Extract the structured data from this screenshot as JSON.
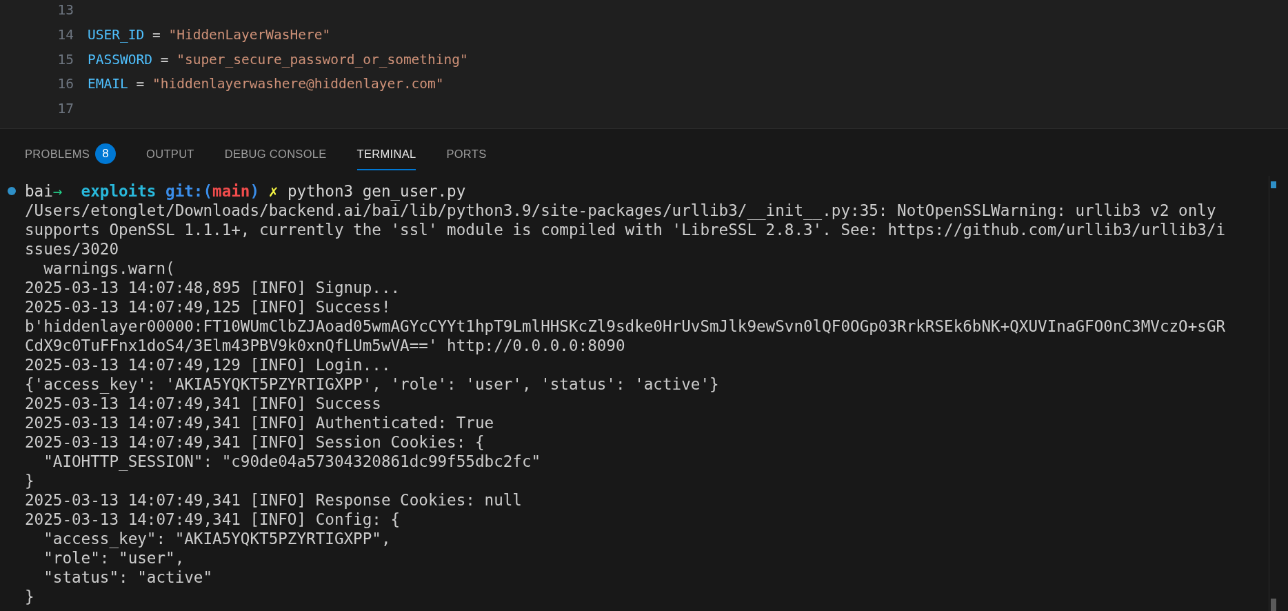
{
  "editor": {
    "lines": [
      {
        "number": "13"
      },
      {
        "number": "14",
        "tokens": [
          {
            "kind": "variable",
            "text": "USER_ID"
          },
          {
            "kind": "operator",
            "text": " = "
          },
          {
            "kind": "string",
            "text": "\"HiddenLayerWasHere\""
          }
        ]
      },
      {
        "number": "15",
        "tokens": [
          {
            "kind": "variable",
            "text": "PASSWORD"
          },
          {
            "kind": "operator",
            "text": " = "
          },
          {
            "kind": "string",
            "text": "\"super_secure_password_or_something\""
          }
        ]
      },
      {
        "number": "16",
        "tokens": [
          {
            "kind": "variable",
            "text": "EMAIL"
          },
          {
            "kind": "operator",
            "text": " = "
          },
          {
            "kind": "string",
            "text": "\"hiddenlayerwashere@hiddenlayer.com\""
          }
        ]
      },
      {
        "number": "17"
      }
    ]
  },
  "panel": {
    "tabs": [
      {
        "label": "PROBLEMS",
        "badge": "8",
        "selected": false
      },
      {
        "label": "OUTPUT",
        "selected": false
      },
      {
        "label": "DEBUG CONSOLE",
        "selected": false
      },
      {
        "label": "TERMINAL",
        "selected": true
      },
      {
        "label": "PORTS",
        "selected": false
      }
    ]
  },
  "terminal": {
    "prompt": [
      {
        "kind": "user",
        "text": "bai"
      },
      {
        "kind": "arrow",
        "text": "→"
      },
      {
        "kind": "dir",
        "text": "exploits"
      },
      {
        "kind": "git",
        "text": "git:("
      },
      {
        "kind": "branch",
        "text": "main"
      },
      {
        "kind": "git-close",
        "text": ")"
      },
      {
        "kind": "dirty",
        "text": "✗"
      },
      {
        "kind": "command",
        "text": "python3 gen_user.py"
      }
    ],
    "output": [
      "/Users/etonglet/Downloads/backend.ai/bai/lib/python3.9/site-packages/urllib3/__init__.py:35: NotOpenSSLWarning: urllib3 v2 only",
      "supports OpenSSL 1.1.1+, currently the 'ssl' module is compiled with 'LibreSSL 2.8.3'. See: https://github.com/urllib3/urllib3/i",
      "ssues/3020",
      "  warnings.warn(",
      "2025-03-13 14:07:48,895 [INFO] Signup...",
      "2025-03-13 14:07:49,125 [INFO] Success!",
      "b'hiddenlayer00000:FT10WUmClbZJAoad05wmAGYcCYYt1hpT9LmlHHSKcZl9sdke0HrUvSmJlk9ewSvn0lQF0OGp03RrkRSEk6bNK+QXUVInaGFO0nC3MVczO+sGR",
      "CdX9c0TuFFnx1doS4/3Elm43PBV9k0xnQfLUm5wVA==' http://0.0.0.0:8090",
      "2025-03-13 14:07:49,129 [INFO] Login...",
      "{'access_key': 'AKIA5YQKT5PZYRTIGXPP', 'role': 'user', 'status': 'active'}",
      "2025-03-13 14:07:49,341 [INFO] Success",
      "2025-03-13 14:07:49,341 [INFO] Authenticated: True",
      "2025-03-13 14:07:49,341 [INFO] Session Cookies: {",
      "  \"AIOHTTP_SESSION\": \"c90de04a57304320861dc99f55dbc2fc\"",
      "}",
      "2025-03-13 14:07:49,341 [INFO] Response Cookies: null",
      "2025-03-13 14:07:49,341 [INFO] Config: {",
      "  \"access_key\": \"AKIA5YQKT5PZYRTIGXPP\",",
      "  \"role\": \"user\",",
      "  \"status\": \"active\"",
      "}"
    ]
  }
}
